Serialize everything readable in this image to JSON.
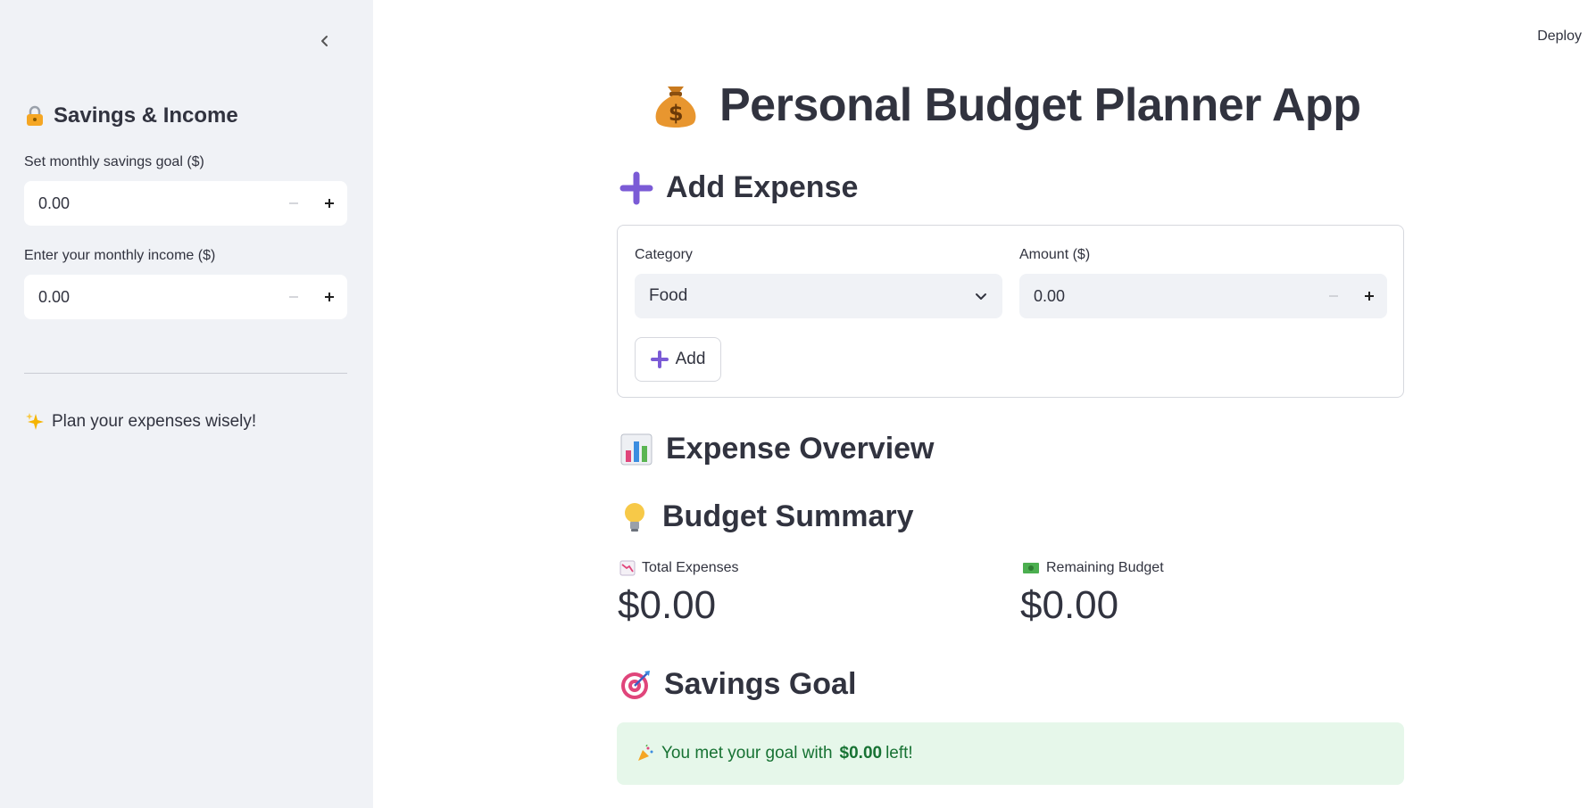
{
  "header": {
    "deploy_label": "Deploy"
  },
  "sidebar": {
    "title": "Savings & Income",
    "title_icon": "lock-icon",
    "savings_goal": {
      "label": "Set monthly savings goal ($)",
      "value": "0.00"
    },
    "income": {
      "label": "Enter your monthly income ($)",
      "value": "0.00"
    },
    "tip": "Plan your expenses wisely!",
    "tip_icon": "sparkles-icon"
  },
  "main": {
    "title": "Personal Budget Planner App",
    "title_icon": "money-bag-icon",
    "add_expense": {
      "heading": "Add Expense",
      "category_label": "Category",
      "category_value": "Food",
      "amount_label": "Amount ($)",
      "amount_value": "0.00",
      "add_button": "Add"
    },
    "overview_heading": "Expense Overview",
    "summary": {
      "heading": "Budget Summary",
      "total_label": "Total Expenses",
      "total_value": "$0.00",
      "remaining_label": "Remaining Budget",
      "remaining_value": "$0.00"
    },
    "savings_goal": {
      "heading": "Savings Goal",
      "message_prefix": "You met your goal with",
      "message_amount": "$0.00",
      "message_suffix": "left!"
    }
  },
  "colors": {
    "sidebar_bg": "#f0f2f6",
    "success_bg": "#e6f7ea",
    "success_text": "#177233",
    "accent_purple": "#7b5bd6"
  }
}
